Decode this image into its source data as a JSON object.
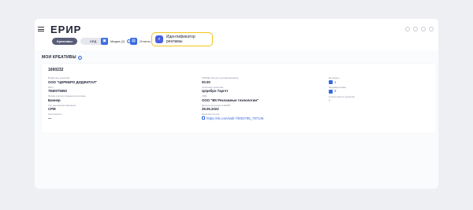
{
  "app": {
    "logo": "ЕРИР"
  },
  "tabs": [
    {
      "label": "Креативы",
      "active": true
    },
    {
      "label": "ОРД",
      "active": false
    }
  ],
  "toolbar": {
    "media_label": "Медиа (2)",
    "media_info": "i",
    "report_label": "Отчеты",
    "highlight_label": "Идентификатор рекламы"
  },
  "section": {
    "title": "МОИ КРЕАТИВЫ",
    "info": "i"
  },
  "card": {
    "id": "1690232",
    "left_fields": [
      {
        "label": "Владелец креатива",
        "value": "ООО \"ЦЕРЕБРО ДИДЖИТАЛ\""
      },
      {
        "label": "ИНН",
        "value": "7840075550"
      },
      {
        "label": "Форма распространения рекламы",
        "value": "Баннер"
      },
      {
        "label": "Тип рекламной кампании",
        "value": "CPM"
      },
      {
        "label": "Контрагенты",
        "value": "—"
      }
    ],
    "middle_fields": [
      {
        "label": "ОКВЭД объекта рекламирования",
        "value": "00.00"
      },
      {
        "label": "Описание креатива",
        "value": "Церебро Таргет"
      },
      {
        "label": "ОРД",
        "value": "ООО \"ВК Рекламные технологии\""
      },
      {
        "label": "Дата регистрации в ЕРИР",
        "value": "28.06.2023"
      },
      {
        "label": "Цепочка ссылок",
        "value": "https://vk.com/wall-70802785_787145"
      }
    ],
    "right_fields": [
      {
        "label": "Договоры",
        "value": "1"
      },
      {
        "label": "Медиакреативы",
        "value": "3"
      },
      {
        "label": "Статистика по креативу",
        "value": "0"
      }
    ]
  },
  "colors": {
    "accent": "#3a6be0",
    "highlight_border": "#f2c318",
    "background": "#eeeff3"
  }
}
